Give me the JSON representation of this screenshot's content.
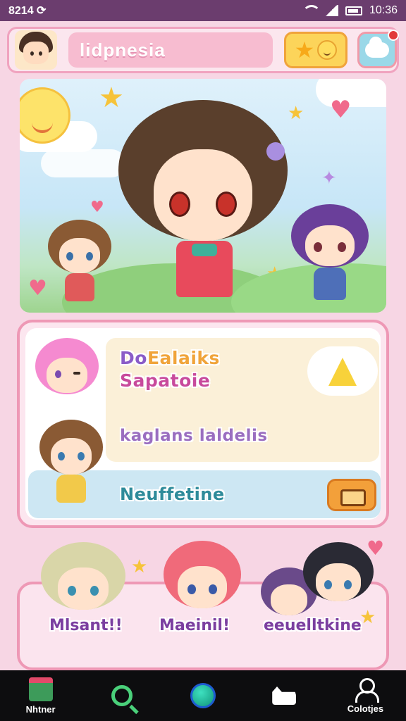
{
  "status_bar": {
    "time_left": "8214 ⟳",
    "time_right": "10:36"
  },
  "header": {
    "title": "lidpnesia",
    "avatar_icon": "user-avatar",
    "star_button_icon": "star-smiley-icon",
    "chat_button_icon": "chat-cloud-icon"
  },
  "menu": {
    "item1_prefix": "Do",
    "item1_rest": "Ealaiks",
    "item2": "Sapatoie",
    "item3": "kaglans laldelis",
    "item4": "Neuffetine"
  },
  "characters_strip": {
    "labels": [
      "Mlsant!!",
      "Maeinil!",
      "eeuelltkine"
    ]
  },
  "navbar": {
    "items": [
      {
        "label": "Nhtner",
        "icon": "home-icon"
      },
      {
        "label": "",
        "icon": "search-icon"
      },
      {
        "label": "",
        "icon": "orb-icon"
      },
      {
        "label": "",
        "icon": "cat-icon"
      },
      {
        "label": "Colotjes",
        "icon": "user-icon"
      }
    ]
  },
  "colors": {
    "status_bar": "#6b3d6e",
    "accent_pink": "#ee98b5",
    "navbar": "#0d0d0f"
  }
}
